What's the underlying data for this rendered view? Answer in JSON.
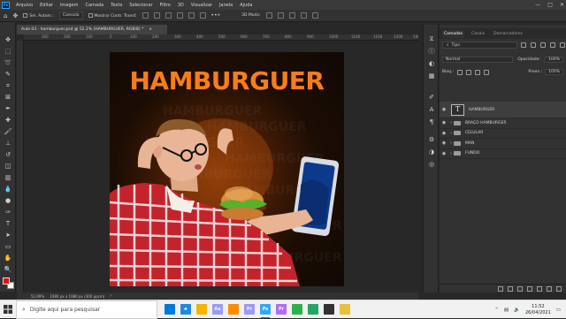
{
  "app": {
    "logo": "Ps",
    "menu": [
      "Arquivo",
      "Editar",
      "Imagem",
      "Camada",
      "Texto",
      "Selecionar",
      "Filtro",
      "3D",
      "Visualizar",
      "Janela",
      "Ajuda"
    ],
    "window_controls": {
      "minimize": "—",
      "maximize": "□",
      "close": "✕"
    }
  },
  "options_bar": {
    "auto_select_label": "Sel. Autom.:",
    "auto_select_target": "Camada",
    "show_transform_label": "Mostrar Contr. Transf."
  },
  "document": {
    "tab_title": "Aula 03 - hamburguer.psd @ 52,1% (HAMBURGUER, RGB/8) *",
    "tab_close": "×",
    "ruler_marks": [
      "300",
      "200",
      "100",
      "0",
      "100",
      "200",
      "300",
      "400",
      "500",
      "600",
      "700",
      "800",
      "900",
      "1000",
      "1100",
      "1200",
      "1300",
      "1400"
    ],
    "zoom": "52,09%",
    "doc_size": "1080 px x 1080 px (300 ppcm)"
  },
  "canvas": {
    "headline": "HAMBURGUER",
    "headline_color": "#f97d16",
    "background_word": "HAMBURGUER"
  },
  "layers_panel": {
    "tabs": [
      "Camadas",
      "Canais",
      "Demarcadores"
    ],
    "active_tab": "Camadas",
    "filter_label": "Tipo",
    "blend_mode": "Normal",
    "opacity_label": "Opacidade:",
    "opacity_value": "100%",
    "lock_label": "Bloq.:",
    "fill_label": "Preen.:",
    "fill_value": "100%",
    "layers": [
      {
        "name": "HAMBURGER",
        "type": "text",
        "thumb": "T"
      },
      {
        "name": "BRAÇO HAMBURGER",
        "type": "group"
      },
      {
        "name": "CELULAR",
        "type": "group"
      },
      {
        "name": "MAN",
        "type": "group"
      },
      {
        "name": "FUNDO",
        "type": "group"
      }
    ]
  },
  "taskbar": {
    "search_placeholder": "Digite aqui para pesquisar",
    "time": "11:52",
    "date": "26/04/2021",
    "apps": [
      {
        "label": "",
        "color": "#0078d7",
        "icon": "task-view-icon"
      },
      {
        "label": "e",
        "color": "#1e88e5",
        "icon": "edge-icon"
      },
      {
        "label": "",
        "color": "#f4b400",
        "icon": "file-explorer-icon"
      },
      {
        "label": "Ae",
        "color": "#9999ff",
        "icon": "after-effects-icon"
      },
      {
        "label": "",
        "color": "#ff8a00",
        "icon": "mixer-icon"
      },
      {
        "label": "Pr",
        "color": "#9999ff",
        "icon": "premiere-icon"
      },
      {
        "label": "Ps",
        "color": "#31a8ff",
        "icon": "photoshop-icon"
      },
      {
        "label": "Pr",
        "color": "#b06cff",
        "icon": "premiere-rush-icon"
      },
      {
        "label": "",
        "color": "#2bb24c",
        "icon": "chrome-icon"
      },
      {
        "label": "",
        "color": "#23a566",
        "icon": "whatsapp-icon"
      },
      {
        "label": "",
        "color": "#333333",
        "icon": "photos-icon"
      },
      {
        "label": "",
        "color": "#e8c040",
        "icon": "folder-icon"
      }
    ]
  }
}
